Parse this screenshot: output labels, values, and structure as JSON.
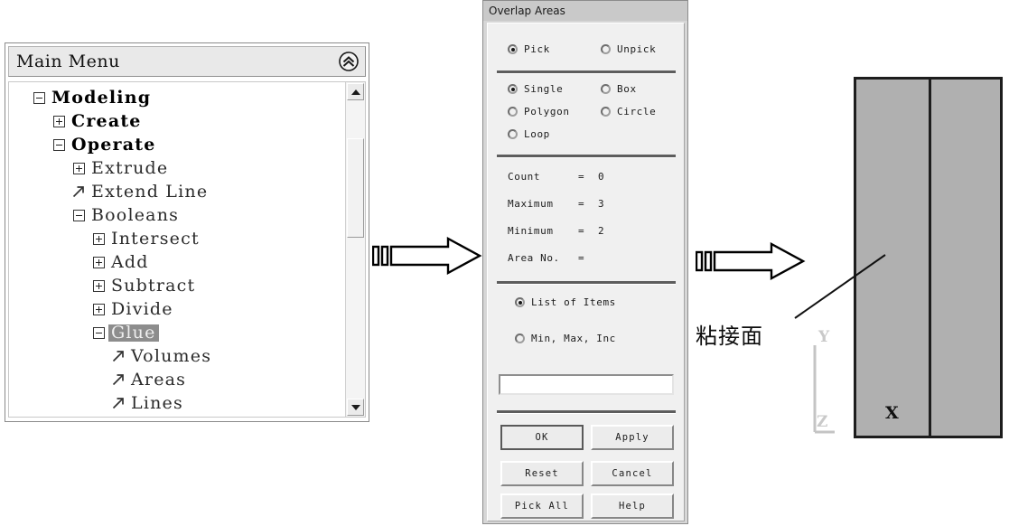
{
  "main_menu": {
    "title": "Main Menu",
    "collapse_icon": "double-chevron-up-icon",
    "tree": [
      {
        "label": "Modeling",
        "indent": 0,
        "marker": "minus",
        "bold": true,
        "selected": false
      },
      {
        "label": "Create",
        "indent": 1,
        "marker": "plus",
        "bold": true,
        "selected": false
      },
      {
        "label": "Operate",
        "indent": 1,
        "marker": "minus",
        "bold": true,
        "selected": false
      },
      {
        "label": "Extrude",
        "indent": 2,
        "marker": "plus",
        "bold": false,
        "selected": false
      },
      {
        "label": "Extend Line",
        "indent": 2,
        "marker": "arrow",
        "bold": false,
        "selected": false
      },
      {
        "label": "Booleans",
        "indent": 2,
        "marker": "minus",
        "bold": false,
        "selected": false
      },
      {
        "label": "Intersect",
        "indent": 3,
        "marker": "plus",
        "bold": false,
        "selected": false
      },
      {
        "label": "Add",
        "indent": 3,
        "marker": "plus",
        "bold": false,
        "selected": false
      },
      {
        "label": "Subtract",
        "indent": 3,
        "marker": "plus",
        "bold": false,
        "selected": false
      },
      {
        "label": "Divide",
        "indent": 3,
        "marker": "plus",
        "bold": false,
        "selected": false
      },
      {
        "label": "Glue",
        "indent": 3,
        "marker": "minus",
        "bold": false,
        "selected": true
      },
      {
        "label": "Volumes",
        "indent": 4,
        "marker": "arrow",
        "bold": false,
        "selected": false
      },
      {
        "label": "Areas",
        "indent": 4,
        "marker": "arrow",
        "bold": false,
        "selected": false
      },
      {
        "label": "Lines",
        "indent": 4,
        "marker": "arrow",
        "bold": false,
        "selected": false
      }
    ],
    "scrollbar": {
      "up_icon": "triangle-up-icon",
      "down_icon": "triangle-down-icon"
    }
  },
  "dialog": {
    "title": "Overlap Areas",
    "pick_mode": [
      {
        "label": "Pick",
        "selected": true
      },
      {
        "label": "Unpick",
        "selected": false
      }
    ],
    "selection_mode": [
      {
        "label": "Single",
        "selected": true
      },
      {
        "label": "Box",
        "selected": false
      },
      {
        "label": "Polygon",
        "selected": false
      },
      {
        "label": "Circle",
        "selected": false
      },
      {
        "label": "Loop",
        "selected": false
      }
    ],
    "info": [
      {
        "key": "Count",
        "eq": "=",
        "value": "0"
      },
      {
        "key": "Maximum",
        "eq": "=",
        "value": "3"
      },
      {
        "key": "Minimum",
        "eq": "=",
        "value": "2"
      },
      {
        "key": "Area No.",
        "eq": "=",
        "value": ""
      }
    ],
    "entry_mode": [
      {
        "label": "List of Items",
        "selected": true
      },
      {
        "label": "Min, Max, Inc",
        "selected": false
      }
    ],
    "input_value": "",
    "input_placeholder": "",
    "buttons": [
      {
        "label": "OK",
        "default": true
      },
      {
        "label": "Apply",
        "default": false
      },
      {
        "label": "Reset",
        "default": false
      },
      {
        "label": "Cancel",
        "default": false
      },
      {
        "label": "Pick All",
        "default": false
      },
      {
        "label": "Help",
        "default": false
      }
    ]
  },
  "flow": {
    "arrow_1_icon": "right-block-arrow-icon",
    "arrow_2_icon": "right-block-arrow-icon"
  },
  "model_view": {
    "callout_label": "粘接面",
    "axis_x_label": "X",
    "axis_y_label": "Y",
    "axis_z_label": "Z",
    "block_fill": "#b0b0b0",
    "outline_color": "#1d1d1d"
  }
}
